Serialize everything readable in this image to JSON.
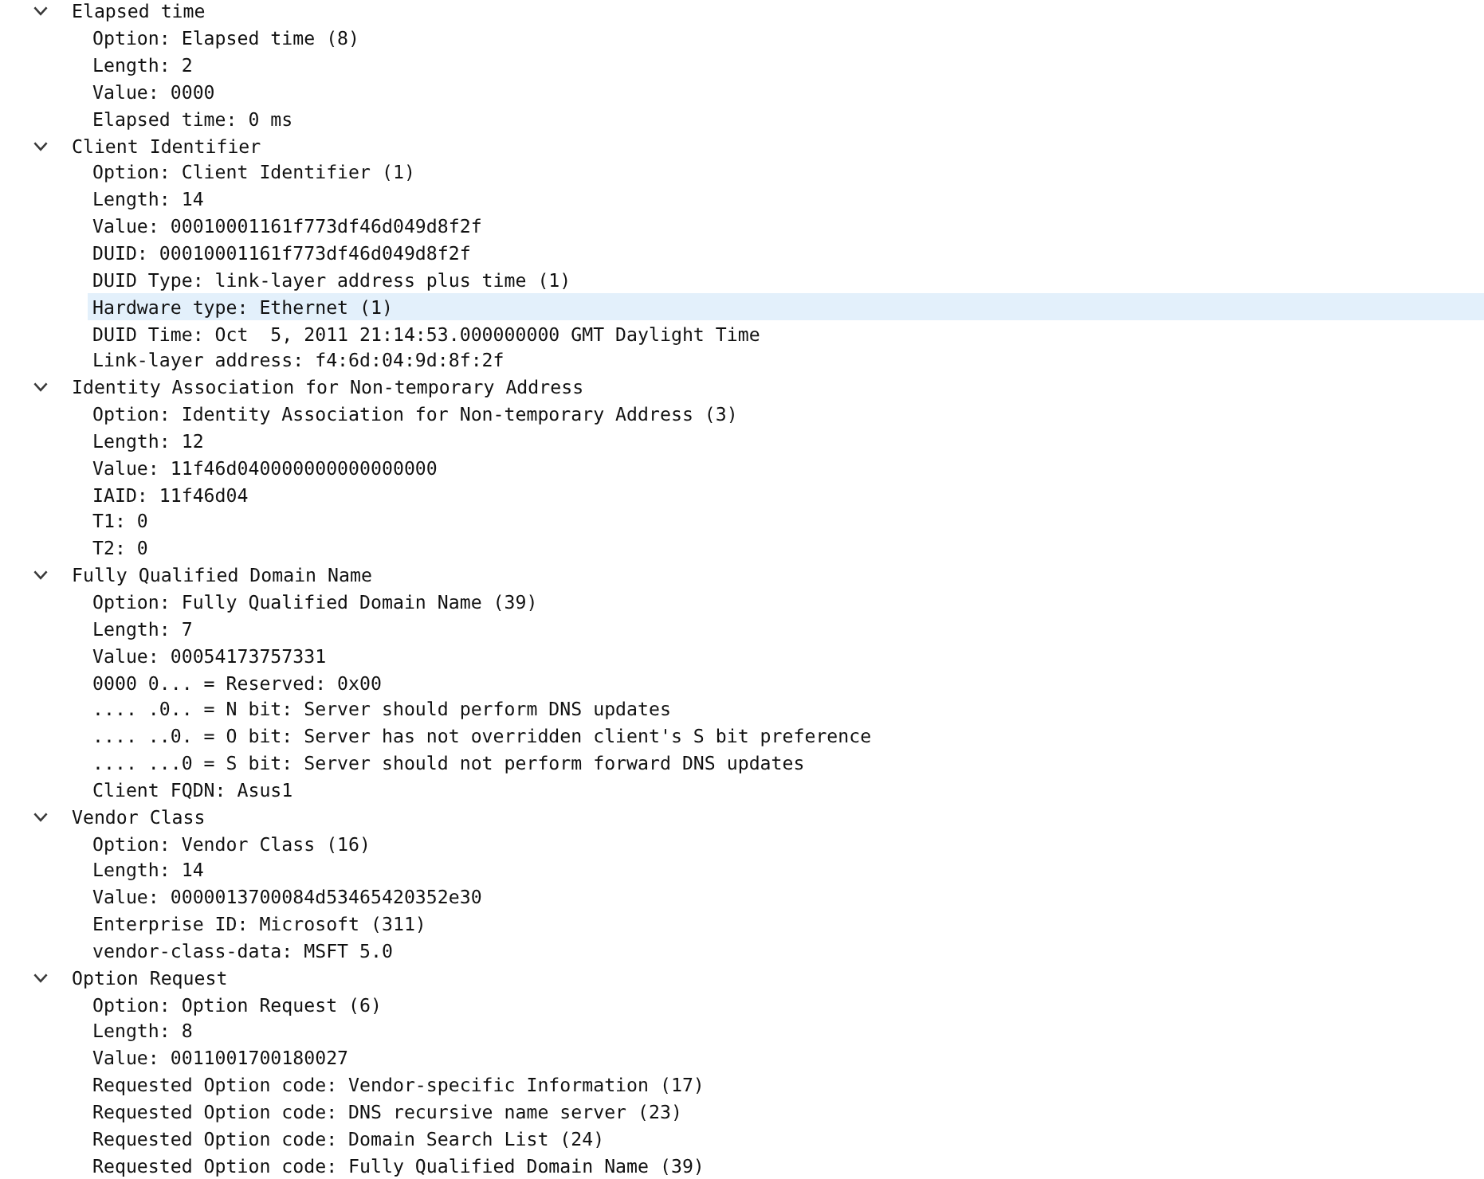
{
  "tree": [
    {
      "label": "Elapsed time",
      "expanded": true,
      "selected": false,
      "children": [
        {
          "label": "Option: Elapsed time (8)",
          "selected": false
        },
        {
          "label": "Length: 2",
          "selected": false
        },
        {
          "label": "Value: 0000",
          "selected": false
        },
        {
          "label": "Elapsed time: 0 ms",
          "selected": false
        }
      ]
    },
    {
      "label": "Client Identifier",
      "expanded": true,
      "selected": false,
      "children": [
        {
          "label": "Option: Client Identifier (1)",
          "selected": false
        },
        {
          "label": "Length: 14",
          "selected": false
        },
        {
          "label": "Value: 00010001161f773df46d049d8f2f",
          "selected": false
        },
        {
          "label": "DUID: 00010001161f773df46d049d8f2f",
          "selected": false
        },
        {
          "label": "DUID Type: link-layer address plus time (1)",
          "selected": false
        },
        {
          "label": "Hardware type: Ethernet (1)",
          "selected": true
        },
        {
          "label": "DUID Time: Oct  5, 2011 21:14:53.000000000 GMT Daylight Time",
          "selected": false
        },
        {
          "label": "Link-layer address: f4:6d:04:9d:8f:2f",
          "selected": false
        }
      ]
    },
    {
      "label": "Identity Association for Non-temporary Address",
      "expanded": true,
      "selected": false,
      "children": [
        {
          "label": "Option: Identity Association for Non-temporary Address (3)",
          "selected": false
        },
        {
          "label": "Length: 12",
          "selected": false
        },
        {
          "label": "Value: 11f46d040000000000000000",
          "selected": false
        },
        {
          "label": "IAID: 11f46d04",
          "selected": false
        },
        {
          "label": "T1: 0",
          "selected": false
        },
        {
          "label": "T2: 0",
          "selected": false
        }
      ]
    },
    {
      "label": "Fully Qualified Domain Name",
      "expanded": true,
      "selected": false,
      "children": [
        {
          "label": "Option: Fully Qualified Domain Name (39)",
          "selected": false
        },
        {
          "label": "Length: 7",
          "selected": false
        },
        {
          "label": "Value: 00054173757331",
          "selected": false
        },
        {
          "label": "0000 0... = Reserved: 0x00",
          "selected": false
        },
        {
          "label": ".... .0.. = N bit: Server should perform DNS updates",
          "selected": false
        },
        {
          "label": ".... ..0. = O bit: Server has not overridden client's S bit preference",
          "selected": false
        },
        {
          "label": ".... ...0 = S bit: Server should not perform forward DNS updates",
          "selected": false
        },
        {
          "label": "Client FQDN: Asus1",
          "selected": false
        }
      ]
    },
    {
      "label": "Vendor Class",
      "expanded": true,
      "selected": false,
      "children": [
        {
          "label": "Option: Vendor Class (16)",
          "selected": false
        },
        {
          "label": "Length: 14",
          "selected": false
        },
        {
          "label": "Value: 0000013700084d53465420352e30",
          "selected": false
        },
        {
          "label": "Enterprise ID: Microsoft (311)",
          "selected": false
        },
        {
          "label": "vendor-class-data: MSFT 5.0",
          "selected": false
        }
      ]
    },
    {
      "label": "Option Request",
      "expanded": true,
      "selected": false,
      "children": [
        {
          "label": "Option: Option Request (6)",
          "selected": false
        },
        {
          "label": "Length: 8",
          "selected": false
        },
        {
          "label": "Value: 0011001700180027",
          "selected": false
        },
        {
          "label": "Requested Option code: Vendor-specific Information (17)",
          "selected": false
        },
        {
          "label": "Requested Option code: DNS recursive name server (23)",
          "selected": false
        },
        {
          "label": "Requested Option code: Domain Search List (24)",
          "selected": false
        },
        {
          "label": "Requested Option code: Fully Qualified Domain Name (39)",
          "selected": false
        }
      ]
    }
  ]
}
